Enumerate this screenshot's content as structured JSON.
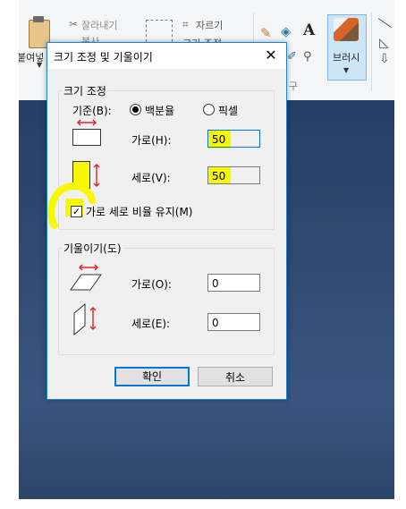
{
  "ribbon": {
    "paste_label": "붙여넣",
    "cut_label": "잘라내기",
    "copy_label": "복사",
    "crop_label": "자르기",
    "resize_label": "크기 조정",
    "tools_label": "구",
    "brush_label": "브러시"
  },
  "dialog": {
    "title": "크기 조정 및 기울이기",
    "resize": {
      "group_label": "크기 조정",
      "basis_label": "기준(B):",
      "options": [
        "백분율",
        "픽셀"
      ],
      "selected": "백분율",
      "horizontal_label": "가로(H):",
      "horizontal_value": "50",
      "vertical_label": "세로(V):",
      "vertical_value": "50",
      "keep_ratio_label": "가로 세로 비율 유지(M)",
      "keep_ratio_checked": true
    },
    "skew": {
      "group_label": "기울이기(도)",
      "horizontal_label": "가로(O):",
      "horizontal_value": "0",
      "vertical_label": "세로(E):",
      "vertical_value": "0"
    },
    "ok_label": "확인",
    "cancel_label": "취소"
  },
  "colors": {
    "highlight": "#f7f700",
    "accent": "#0078d7",
    "arrow_red": "#d9252a",
    "canvas_blue": "#304a71"
  },
  "icons": [
    "paste-icon",
    "cut-icon",
    "select-icon",
    "crop-icon",
    "pencil-icon",
    "fill-icon",
    "text-icon",
    "color-picker-icon",
    "magnifier-icon",
    "brush-icon",
    "close-icon",
    "resize-horizontal-icon",
    "resize-vertical-icon",
    "skew-horizontal-icon",
    "skew-vertical-icon"
  ]
}
